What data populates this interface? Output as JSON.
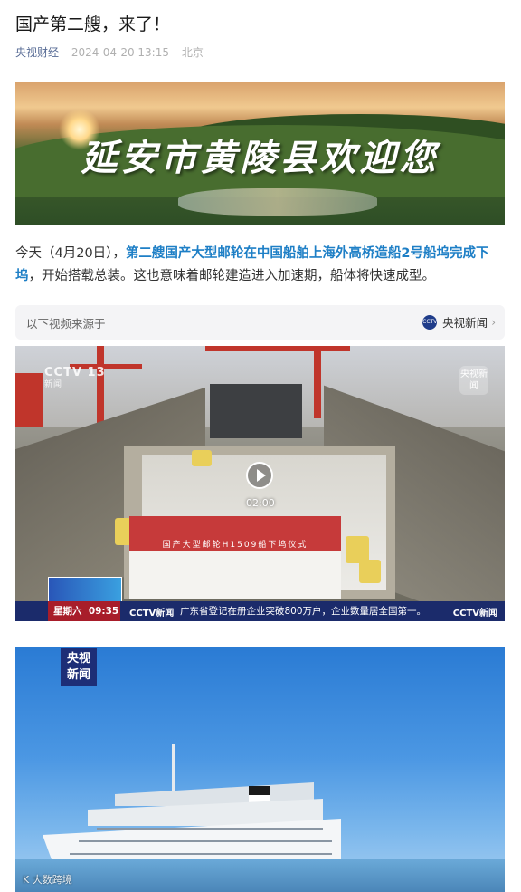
{
  "article": {
    "title": "国产第二艘，来了！",
    "author": "央视财经",
    "datetime": "2024-04-20 13:15",
    "location": "北京"
  },
  "banner": {
    "slogan": "延安市黄陵县欢迎您"
  },
  "paragraph": {
    "prefix": "今天（4月20日），",
    "highlight": "第二艘国产大型邮轮在中国船舶上海外高桥造船2号船坞完成下坞",
    "suffix": "，开始搭载总装。这也意味着邮轮建造进入加速期，船体将快速成型。"
  },
  "source_bar": {
    "label": "以下视频来源于",
    "channel": "央视新闻",
    "chevron": "›",
    "logo_icon": "cctv-news-logo-icon"
  },
  "video": {
    "duration": "02:00",
    "watermark_left": "CCTV 13",
    "watermark_left_sub": "新闻",
    "watermark_right": "央视新闻",
    "banner_text": "国产大型邮轮H1509船下坞仪式",
    "ticker_day": "星期六",
    "ticker_time": "09:35",
    "ticker_logo": "CCTV新闻",
    "ticker_text": "广东省登记在册企业突破800万户，企业数量居全国第一。",
    "ticker_logo_right": "CCTV新闻",
    "play_icon": "play-icon"
  },
  "photo": {
    "brand_line1": "央视",
    "brand_line2": "新闻",
    "watermark": "K 大数跨境"
  }
}
